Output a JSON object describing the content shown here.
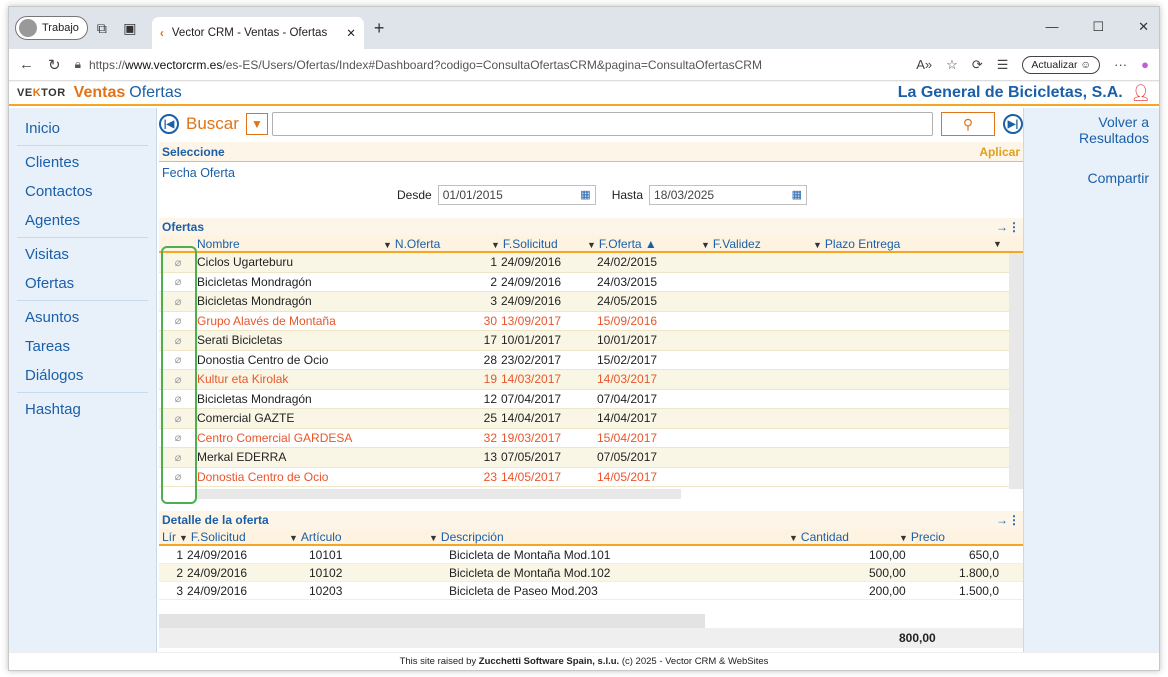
{
  "browser": {
    "profile": "Trabajo",
    "tab_title": "Vector CRM - Ventas - Ofertas",
    "url_prefix": "https://",
    "url_host": "www.vectorcrm.es",
    "url_path": "/es-ES/Users/Ofertas/Index#Dashboard?codigo=ConsultaOfertasCRM&pagina=ConsultaOfertasCRM",
    "update_label": "Actualizar"
  },
  "header": {
    "logo_a": "VE",
    "logo_b": "K",
    "logo_c": "TOR",
    "module": "Ventas",
    "page": "Ofertas",
    "company": "La General de Bicicletas, S.A."
  },
  "sidebar": {
    "items": [
      "Inicio",
      "Clientes",
      "Contactos",
      "Agentes",
      "Visitas",
      "Ofertas",
      "Asuntos",
      "Tareas",
      "Diálogos",
      "Hashtag"
    ]
  },
  "rightbar": {
    "back_1": "Volver a",
    "back_2": "Resultados",
    "share": "Compartir"
  },
  "search": {
    "label": "Buscar",
    "value": ""
  },
  "filter": {
    "title": "Seleccione",
    "apply": "Aplicar",
    "field": "Fecha Oferta",
    "from_label": "Desde",
    "from_value": "01/01/2015",
    "to_label": "Hasta",
    "to_value": "18/03/2025"
  },
  "ofertas": {
    "title": "Ofertas",
    "columns": [
      "Nombre",
      "N.Oferta",
      "F.Solicitud",
      "F.Oferta ▲",
      "F.Validez",
      "Plazo Entrega"
    ],
    "rows": [
      {
        "nombre": "Ciclos Ugarteburu",
        "n": "1",
        "sol": "24/09/2016",
        "of": "24/02/2015",
        "red": false
      },
      {
        "nombre": "Bicicletas Mondragón",
        "n": "2",
        "sol": "24/09/2016",
        "of": "24/03/2015",
        "red": false
      },
      {
        "nombre": "Bicicletas Mondragón",
        "n": "3",
        "sol": "24/09/2016",
        "of": "24/05/2015",
        "red": false
      },
      {
        "nombre": "Grupo Alavés de Montaña",
        "n": "30",
        "sol": "13/09/2017",
        "of": "15/09/2016",
        "red": true
      },
      {
        "nombre": "Serati Bicicletas",
        "n": "17",
        "sol": "10/01/2017",
        "of": "10/01/2017",
        "red": false
      },
      {
        "nombre": "Donostia Centro de Ocio",
        "n": "28",
        "sol": "23/02/2017",
        "of": "15/02/2017",
        "red": false
      },
      {
        "nombre": "Kultur eta Kirolak",
        "n": "19",
        "sol": "14/03/2017",
        "of": "14/03/2017",
        "red": true
      },
      {
        "nombre": "Bicicletas Mondragón",
        "n": "12",
        "sol": "07/04/2017",
        "of": "07/04/2017",
        "red": false
      },
      {
        "nombre": "Comercial GAZTE",
        "n": "25",
        "sol": "14/04/2017",
        "of": "14/04/2017",
        "red": false
      },
      {
        "nombre": "Centro Comercial GARDESA",
        "n": "32",
        "sol": "19/03/2017",
        "of": "15/04/2017",
        "red": true
      },
      {
        "nombre": "Merkal EDERRA",
        "n": "13",
        "sol": "07/05/2017",
        "of": "07/05/2017",
        "red": false
      },
      {
        "nombre": "Donostia Centro de Ocio",
        "n": "23",
        "sol": "14/05/2017",
        "of": "14/05/2017",
        "red": true
      }
    ]
  },
  "detalle": {
    "title": "Detalle de la oferta",
    "columns": [
      "Lír",
      "F.Solicitud",
      "Artículo",
      "Descripción",
      "Cantidad",
      "Precio"
    ],
    "rows": [
      {
        "lin": "1",
        "sol": "24/09/2016",
        "art": "10101",
        "desc": "Bicicleta de Montaña Mod.101",
        "cant": "100,00",
        "precio": "650,0"
      },
      {
        "lin": "2",
        "sol": "24/09/2016",
        "art": "10102",
        "desc": "Bicicleta de Montaña Mod.102",
        "cant": "500,00",
        "precio": "1.800,0"
      },
      {
        "lin": "3",
        "sol": "24/09/2016",
        "art": "10203",
        "desc": "Bicicleta de Paseo Mod.203",
        "cant": "200,00",
        "precio": "1.500,0"
      }
    ],
    "total": "800,00"
  },
  "footer": {
    "pre": "This site raised by ",
    "company": "Zucchetti Software Spain, s.l.u.",
    "post": " (c) 2025 - Vector CRM & WebSites"
  }
}
